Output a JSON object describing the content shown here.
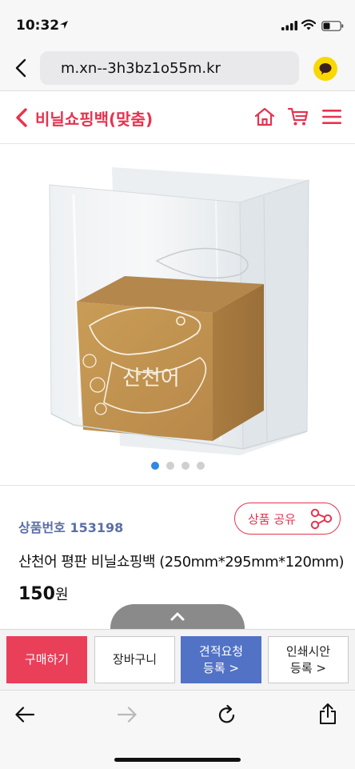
{
  "status_bar": {
    "time": "10:32"
  },
  "browser": {
    "url": "m.xn--3h3bz1o55m.kr"
  },
  "header": {
    "title": "비닐쇼핑백(맞춤)",
    "accent_color": "#e6334f"
  },
  "carousel": {
    "total": 4,
    "active_index": 0
  },
  "product": {
    "number_label": "상품번호 153198",
    "share_label": "상품 공유",
    "name": "산천어 평판 비닐쇼핑백 (250mm*295mm*120mm)",
    "price": "150",
    "price_unit": "원",
    "box_text": "산천어"
  },
  "actions": {
    "buy": "구매하기",
    "cart": "장바구니",
    "quote": "견적요청\n등록 >",
    "print": "인쇄시안\n등록 >"
  },
  "colors": {
    "primary_red": "#ea3f59",
    "quote_blue": "#5172c5",
    "dot_active": "#2d88e6",
    "kakao_yellow": "#f9d800"
  }
}
